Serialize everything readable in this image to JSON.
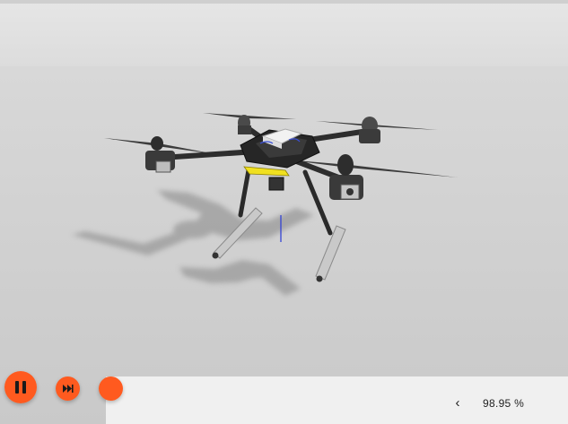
{
  "theme": {
    "accent": "#ff5a1f",
    "sky": "#dedede",
    "ground": "#d0d0d0",
    "panel": "#f0f0f0"
  },
  "controls": {
    "pause_icon": "pause-icon",
    "fast_forward_icon": "fast-forward-icon"
  },
  "status": {
    "chevron": "‹",
    "real_time_factor": "98.95 %"
  },
  "scene": {
    "model": "quadcopter-drone"
  }
}
